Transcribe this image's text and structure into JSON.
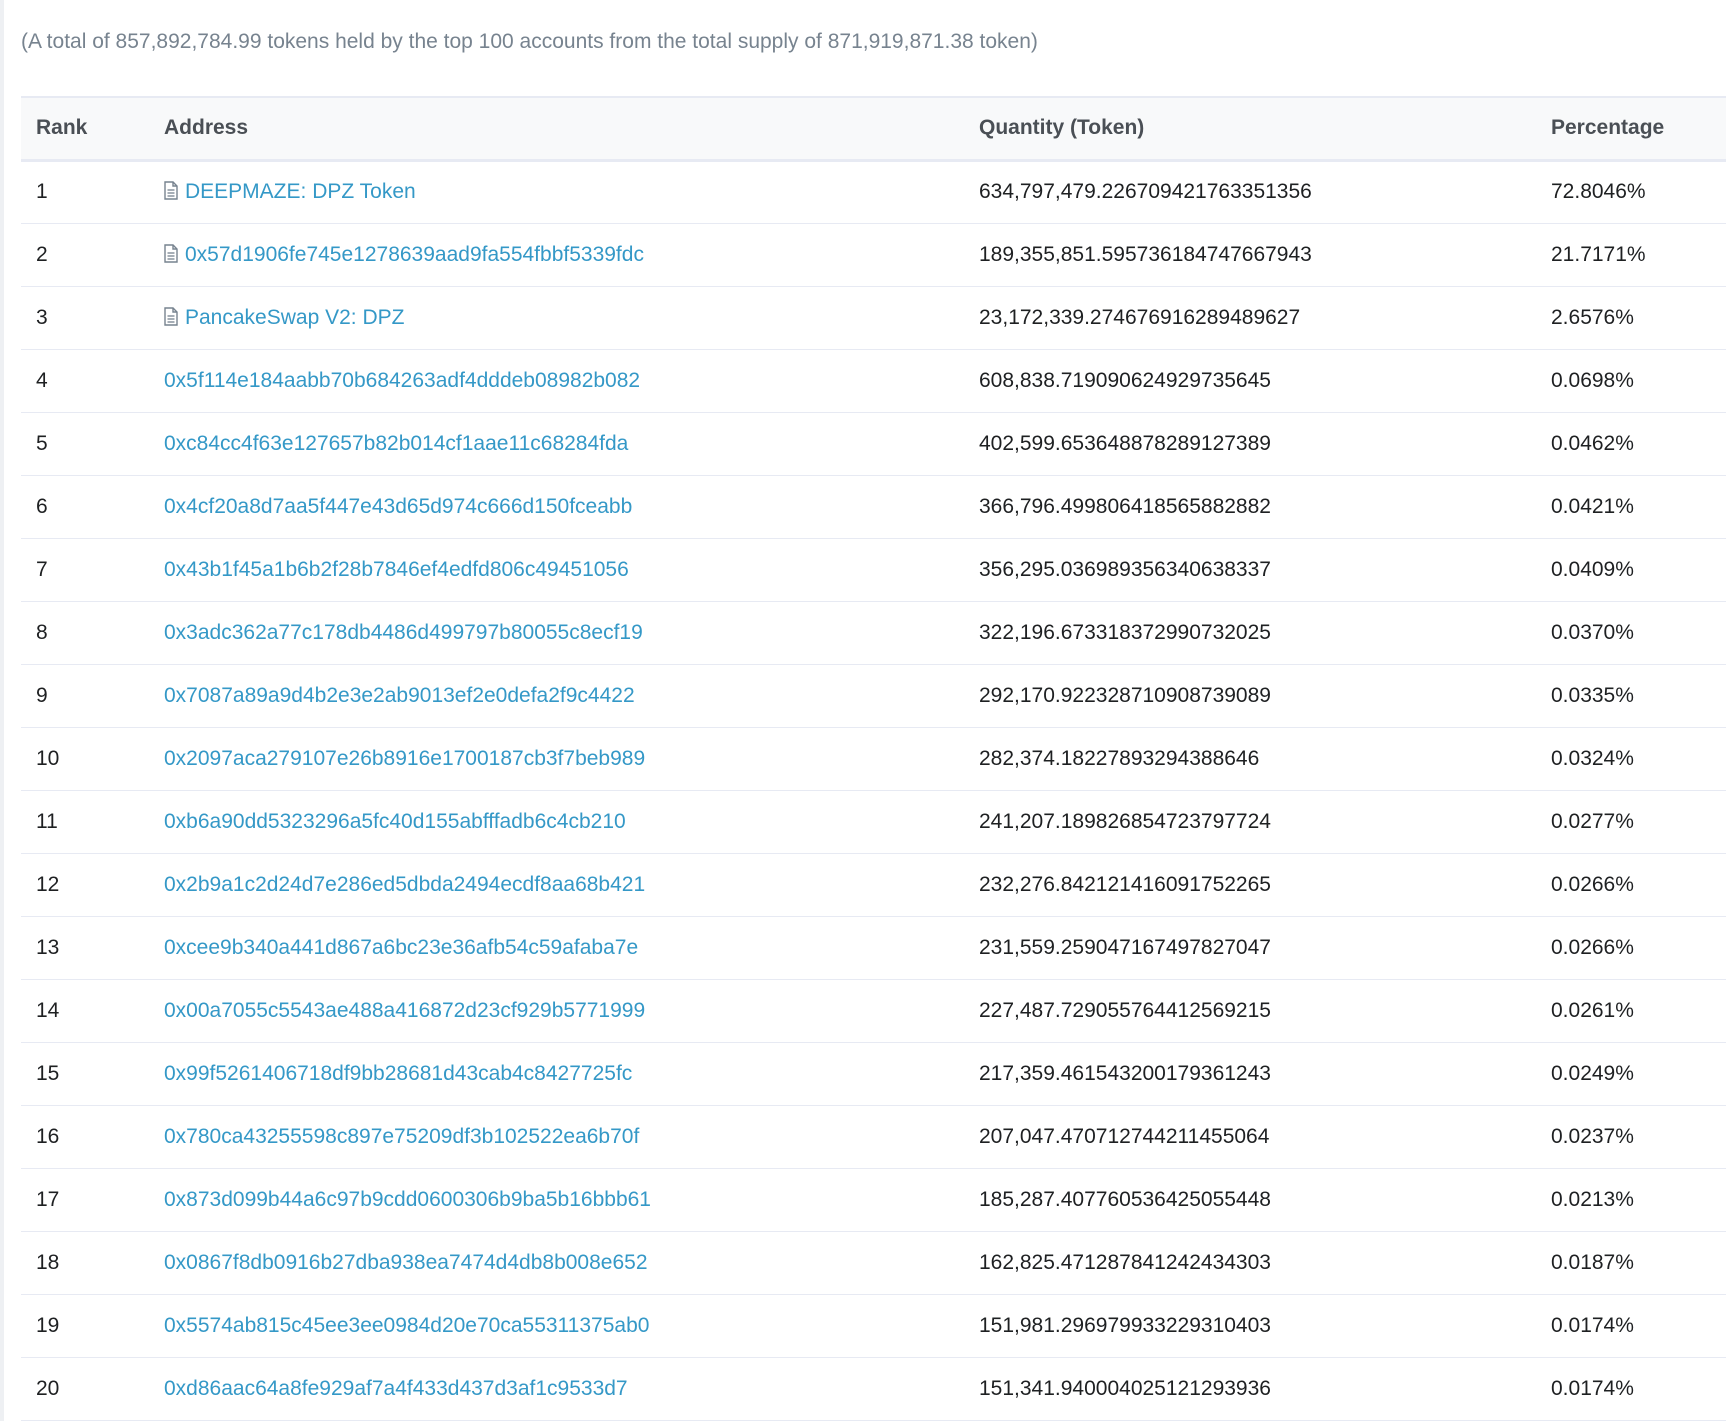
{
  "summary": "(A total of 857,892,784.99 tokens held by the top 100 accounts from the total supply of 871,919,871.38 token)",
  "table": {
    "headers": {
      "rank": "Rank",
      "address": "Address",
      "quantity": "Quantity (Token)",
      "percentage": "Percentage"
    },
    "rows": [
      {
        "rank": "1",
        "address": "DEEPMAZE: DPZ Token",
        "contract": true,
        "quantity": "634,797,479.226709421763351356",
        "percentage": "72.8046%"
      },
      {
        "rank": "2",
        "address": "0x57d1906fe745e1278639aad9fa554fbbf5339fdc",
        "contract": true,
        "quantity": "189,355,851.595736184747667943",
        "percentage": "21.7171%"
      },
      {
        "rank": "3",
        "address": "PancakeSwap V2: DPZ",
        "contract": true,
        "quantity": "23,172,339.274676916289489627",
        "percentage": "2.6576%"
      },
      {
        "rank": "4",
        "address": "0x5f114e184aabb70b684263adf4dddeb08982b082",
        "contract": false,
        "quantity": "608,838.719090624929735645",
        "percentage": "0.0698%"
      },
      {
        "rank": "5",
        "address": "0xc84cc4f63e127657b82b014cf1aae11c68284fda",
        "contract": false,
        "quantity": "402,599.653648878289127389",
        "percentage": "0.0462%"
      },
      {
        "rank": "6",
        "address": "0x4cf20a8d7aa5f447e43d65d974c666d150fceabb",
        "contract": false,
        "quantity": "366,796.499806418565882882",
        "percentage": "0.0421%"
      },
      {
        "rank": "7",
        "address": "0x43b1f45a1b6b2f28b7846ef4edfd806c49451056",
        "contract": false,
        "quantity": "356,295.036989356340638337",
        "percentage": "0.0409%"
      },
      {
        "rank": "8",
        "address": "0x3adc362a77c178db4486d499797b80055c8ecf19",
        "contract": false,
        "quantity": "322,196.673318372990732025",
        "percentage": "0.0370%"
      },
      {
        "rank": "9",
        "address": "0x7087a89a9d4b2e3e2ab9013ef2e0defa2f9c4422",
        "contract": false,
        "quantity": "292,170.922328710908739089",
        "percentage": "0.0335%"
      },
      {
        "rank": "10",
        "address": "0x2097aca279107e26b8916e1700187cb3f7beb989",
        "contract": false,
        "quantity": "282,374.18227893294388646",
        "percentage": "0.0324%"
      },
      {
        "rank": "11",
        "address": "0xb6a90dd5323296a5fc40d155abfffadb6c4cb210",
        "contract": false,
        "quantity": "241,207.189826854723797724",
        "percentage": "0.0277%"
      },
      {
        "rank": "12",
        "address": "0x2b9a1c2d24d7e286ed5dbda2494ecdf8aa68b421",
        "contract": false,
        "quantity": "232,276.842121416091752265",
        "percentage": "0.0266%"
      },
      {
        "rank": "13",
        "address": "0xcee9b340a441d867a6bc23e36afb54c59afaba7e",
        "contract": false,
        "quantity": "231,559.259047167497827047",
        "percentage": "0.0266%"
      },
      {
        "rank": "14",
        "address": "0x00a7055c5543ae488a416872d23cf929b5771999",
        "contract": false,
        "quantity": "227,487.729055764412569215",
        "percentage": "0.0261%"
      },
      {
        "rank": "15",
        "address": "0x99f5261406718df9bb28681d43cab4c8427725fc",
        "contract": false,
        "quantity": "217,359.461543200179361243",
        "percentage": "0.0249%"
      },
      {
        "rank": "16",
        "address": "0x780ca43255598c897e75209df3b102522ea6b70f",
        "contract": false,
        "quantity": "207,047.470712744211455064",
        "percentage": "0.0237%"
      },
      {
        "rank": "17",
        "address": "0x873d099b44a6c97b9cdd0600306b9ba5b16bbb61",
        "contract": false,
        "quantity": "185,287.407760536425055448",
        "percentage": "0.0213%"
      },
      {
        "rank": "18",
        "address": "0x0867f8db0916b27dba938ea7474d4db8b008e652",
        "contract": false,
        "quantity": "162,825.471287841242434303",
        "percentage": "0.0187%"
      },
      {
        "rank": "19",
        "address": "0x5574ab815c45ee3ee0984d20e70ca55311375ab0",
        "contract": false,
        "quantity": "151,981.296979933229310403",
        "percentage": "0.0174%"
      },
      {
        "rank": "20",
        "address": "0xd86aac64a8fe929af7a4f433d437d3af1c9533d7",
        "contract": false,
        "quantity": "151,341.940004025121293936",
        "percentage": "0.0174%"
      }
    ]
  },
  "icons": {
    "contract": "contract-file-icon"
  },
  "colors": {
    "link": "#3498c7",
    "summary_text": "#77838f",
    "header_bg": "#f8f9fa",
    "border": "#e7eaf3"
  }
}
